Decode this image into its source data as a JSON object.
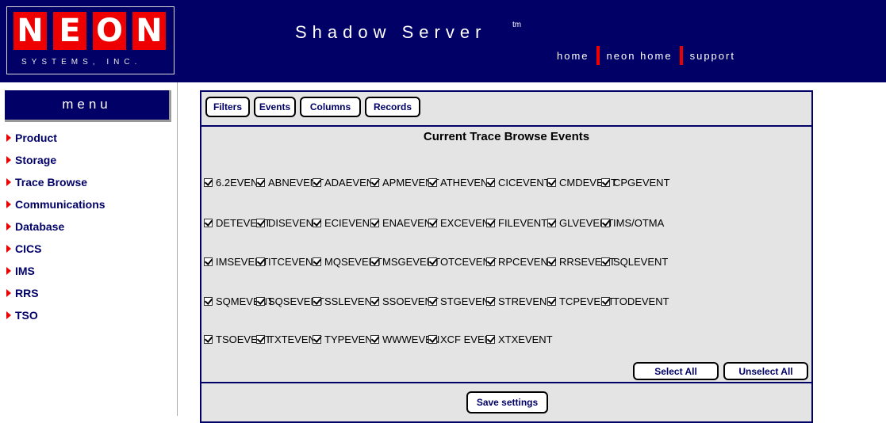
{
  "colors": {
    "header_bg": "#000066",
    "accent": "#ee0000",
    "panel_bg": "#e4e4e4"
  },
  "logo": {
    "letters": [
      "N",
      "E",
      "O",
      "N"
    ],
    "subtitle": "SYSTEMS, INC."
  },
  "header": {
    "title": "Shadow Server",
    "trademark": "tm",
    "nav": [
      "home",
      "neon home",
      "support"
    ]
  },
  "menu": {
    "title": "menu",
    "items": [
      "Product",
      "Storage",
      "Trace Browse",
      "Communications",
      "Database",
      "CICS",
      "IMS",
      "RRS",
      "TSO"
    ]
  },
  "toolbar": {
    "buttons": [
      "Filters",
      "Events",
      "Columns",
      "Records"
    ]
  },
  "panel": {
    "title": "Current Trace Browse Events"
  },
  "events": [
    [
      "6.2EVENT",
      "ABNEVENT",
      "ADAEVENT",
      "APMEVENT",
      "ATHEVENT",
      "CICEVENT",
      "CMDEVENT",
      "CPGEVENT"
    ],
    [
      "DETEVENT",
      "DISEVENT",
      "ECIEVENT",
      "ENAEVENT",
      "EXCEVENT",
      "FILEVENT",
      "GLVEVENT",
      "IMS/OTMA"
    ],
    [
      "IMSEVENT",
      "ITCEVENT",
      "MQSEVENT",
      "MSGEVENT",
      "OTCEVENT",
      "RPCEVENT",
      "RRSEVENT",
      "SQLEVENT"
    ],
    [
      "SQMEVENT",
      "SQSEVENT",
      "SSLEVENT",
      "SSOEVENT",
      "STGEVENT",
      "STREVENT",
      "TCPEVENT",
      "TODEVENT"
    ],
    [
      "TSOEVENT",
      "TXTEVENT",
      "TYPEVENT",
      "WWWEVEN",
      "XCF EVEN",
      "XTXEVENT"
    ]
  ],
  "events_checked": true,
  "actions": {
    "select_all": "Select All",
    "unselect_all": "Unselect All",
    "save": "Save settings"
  }
}
